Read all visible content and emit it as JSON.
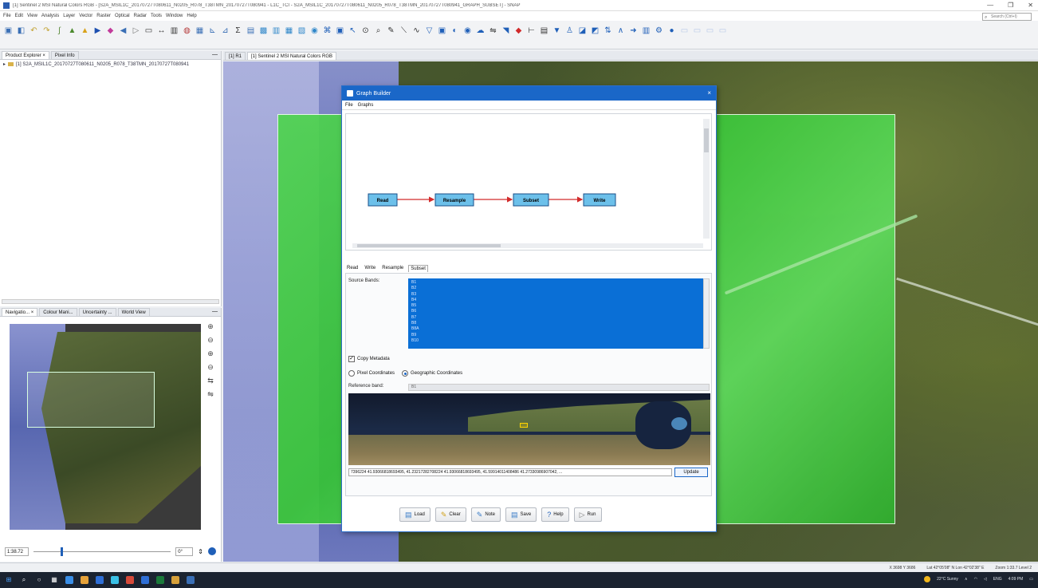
{
  "window": {
    "title": "[1] Sentinel 2 MSI Natural Colors RGB - [S2A_MSIL1C_20170727T080611_N0205_R078_T38TMN_20170727T080941 - L1C_TCI - S2A_MSIL1C_20170727T080611_N0205_R078_T38TMN_20170727T080941_GRAPH_SUBSET] - SNAP"
  },
  "menu": [
    "File",
    "Edit",
    "View",
    "Analysis",
    "Layer",
    "Vector",
    "Raster",
    "Optical",
    "Radar",
    "Tools",
    "Window",
    "Help"
  ],
  "search": {
    "placeholder": "Search (Ctrl+I)"
  },
  "toolbar": {
    "icons": [
      {
        "name": "open-product-icon",
        "glyph": "▣",
        "color": "#3a6fb5"
      },
      {
        "name": "session-icon",
        "glyph": "◧",
        "color": "#3a6fb5"
      },
      {
        "name": "undo-icon",
        "glyph": "↶",
        "color": "#c2a232"
      },
      {
        "name": "redo-icon",
        "glyph": "↷",
        "color": "#c2a232"
      },
      {
        "name": "band-maths-icon",
        "glyph": "∫",
        "color": "#5a8a3a"
      },
      {
        "name": "spectrum-icon",
        "glyph": "▲",
        "color": "#4c8a2e"
      },
      {
        "name": "mask-icon",
        "glyph": "▲",
        "color": "#d8a21b"
      },
      {
        "name": "pin-icon",
        "glyph": "▶",
        "color": "#1d4fb0"
      },
      {
        "name": "zoom-tool-icon",
        "glyph": "◆",
        "color": "#c23b9b"
      },
      {
        "name": "pan-tool-icon",
        "glyph": "◀",
        "color": "#3a6fb5"
      },
      {
        "name": "select-icon",
        "glyph": "▷",
        "color": "#777"
      },
      {
        "name": "rectangle-icon",
        "glyph": "▭",
        "color": "#333"
      },
      {
        "name": "measure-icon",
        "glyph": "↔",
        "color": "#333"
      },
      {
        "name": "histogram-icon",
        "glyph": "▥",
        "color": "#333"
      },
      {
        "name": "world-map-icon",
        "glyph": "◍",
        "color": "#b53a3a"
      },
      {
        "name": "scatter-icon",
        "glyph": "▦",
        "color": "#3a6fb5"
      },
      {
        "name": "profile-icon",
        "glyph": "⊾",
        "color": "#3a6fb5"
      },
      {
        "name": "chart-icon",
        "glyph": "⊿",
        "color": "#3a6fb5"
      },
      {
        "name": "statistics-icon",
        "glyph": "Σ",
        "color": "#333"
      },
      {
        "name": "layers-icon",
        "glyph": "▤",
        "color": "#3a6fb5"
      },
      {
        "name": "gcp-icon",
        "glyph": "▩",
        "color": "#2e86c9"
      },
      {
        "name": "graph-icon",
        "glyph": "▥",
        "color": "#2e86c9"
      },
      {
        "name": "spectral-icon",
        "glyph": "▦",
        "color": "#2e86c9"
      },
      {
        "name": "time-series-icon",
        "glyph": "▧",
        "color": "#2e86c9"
      },
      {
        "name": "colour-icon",
        "glyph": "◉",
        "color": "#2e86c9"
      },
      {
        "name": "graph-builder-icon",
        "glyph": "⌘",
        "color": "#1f5fb8"
      },
      {
        "name": "batch-icon",
        "glyph": "▣",
        "color": "#1f5fb8"
      },
      {
        "name": "cursor-icon",
        "glyph": "↖",
        "color": "#1f5fb8"
      },
      {
        "name": "ellipse-icon",
        "glyph": "⊙",
        "color": "#333"
      },
      {
        "name": "zoom-icon",
        "glyph": "⌕",
        "color": "#333"
      },
      {
        "name": "draw-icon",
        "glyph": "✎",
        "color": "#333"
      },
      {
        "name": "line-icon",
        "glyph": "⟍",
        "color": "#333"
      },
      {
        "name": "polyline-icon",
        "glyph": "∿",
        "color": "#333"
      },
      {
        "name": "polygon-icon",
        "glyph": "▽",
        "color": "#1f5fb8"
      },
      {
        "name": "pixel-info-icon",
        "glyph": "▣",
        "color": "#1f5fb8"
      },
      {
        "name": "range-finder-icon",
        "glyph": "◐",
        "color": "#1f5fb8"
      },
      {
        "name": "magic-wand-icon",
        "glyph": "◉",
        "color": "#1f5fb8"
      },
      {
        "name": "cloud-icon",
        "glyph": "☁",
        "color": "#1f5fb8"
      },
      {
        "name": "sync-cursor-icon",
        "glyph": "⇋",
        "color": "#333"
      },
      {
        "name": "insert-pin-icon",
        "glyph": "◥",
        "color": "#1f5fb8"
      },
      {
        "name": "insert-gcp-icon",
        "glyph": "◆",
        "color": "#d12a2a"
      },
      {
        "name": "split-icon",
        "glyph": "⊢",
        "color": "#333"
      },
      {
        "name": "bars-icon",
        "glyph": "▤",
        "color": "#333"
      },
      {
        "name": "mask-manager-icon",
        "glyph": "▼",
        "color": "#1f5fb8"
      },
      {
        "name": "user-icon",
        "glyph": "♙",
        "color": "#1f5fb8"
      },
      {
        "name": "filter-icon",
        "glyph": "◪",
        "color": "#1f5fb8"
      },
      {
        "name": "colour-manipulation-icon",
        "glyph": "◩",
        "color": "#1f5fb8"
      },
      {
        "name": "sync-view-icon",
        "glyph": "⇅",
        "color": "#1f5fb8"
      },
      {
        "name": "wavelength-icon",
        "glyph": "∧",
        "color": "#1f5fb8"
      },
      {
        "name": "arrow-icon",
        "glyph": "➜",
        "color": "#1f5fb8"
      },
      {
        "name": "analysis-icon",
        "glyph": "▥",
        "color": "#1f5fb8"
      },
      {
        "name": "settings-icon",
        "glyph": "⚙",
        "color": "#1f5fb8"
      },
      {
        "name": "globe-icon",
        "glyph": "●",
        "color": "#1f5fb8"
      },
      {
        "name": "tile-1-icon",
        "glyph": "▭",
        "color": "#b6c7e8"
      },
      {
        "name": "tile-2-icon",
        "glyph": "▭",
        "color": "#b6c7e8"
      },
      {
        "name": "tile-3-icon",
        "glyph": "▭",
        "color": "#b6c7e8"
      },
      {
        "name": "tile-4-icon",
        "glyph": "▭",
        "color": "#b6c7e8"
      }
    ]
  },
  "product_explorer": {
    "tabs": [
      "Product Explorer",
      "Pixel Info"
    ],
    "close": "×",
    "minimize": "—",
    "item": "[1] S2A_MSIL1C_20170727T080611_N0205_R078_T38TMN_20170727T080941"
  },
  "navigation": {
    "tabs": [
      "Navigatio...",
      "Colour Mani...",
      "Uncertainty ...",
      "World View"
    ],
    "close": "×",
    "minimize": "—",
    "scale": "1:38.72",
    "rotation": "0°",
    "zoom_in_icon": "+",
    "zoom_out_icon": "−"
  },
  "map_tabs": [
    "[1] R1",
    "[1] Sentinel 2 MSI Natural Colors RGB"
  ],
  "dialog": {
    "title": "Graph Builder",
    "close": "×",
    "menu": [
      "File",
      "Graphs"
    ],
    "nodes": [
      "Read",
      "Resample",
      "Subset",
      "Write"
    ],
    "tabs": [
      "Read",
      "Write",
      "Resample",
      "Subset"
    ],
    "active_tab": "Subset",
    "source_bands_label": "Source Bands:",
    "bands": [
      "B1",
      "B2",
      "B3",
      "B4",
      "B5",
      "B6",
      "B7",
      "B8",
      "B8A",
      "B9",
      "B10"
    ],
    "copy_metadata_label": "Copy Metadata",
    "copy_metadata_checked": true,
    "pixel_coordinates_label": "Pixel Coordinates",
    "geographic_coordinates_label": "Geographic Coordinates",
    "geo_selected": true,
    "reference_band_label": "Reference band:",
    "reference_band_value": "B1",
    "geo_region": "7396224 41.93066818693495, 41.23217282708224 41.93066818693495, 41.59914011408486 41.27330986907042, ...",
    "update_label": "Update",
    "buttons": [
      {
        "label": "Load",
        "icon": "▤",
        "color": "#3a7dc8"
      },
      {
        "label": "Clear",
        "icon": "✎",
        "color": "#d1a21c"
      },
      {
        "label": "Note",
        "icon": "✎",
        "color": "#3a7dc8"
      },
      {
        "label": "Save",
        "icon": "▤",
        "color": "#3a7dc8"
      },
      {
        "label": "Help",
        "icon": "?",
        "color": "#1f5fb8"
      },
      {
        "label": "Run",
        "icon": "▷",
        "color": "#777"
      }
    ]
  },
  "status": {
    "position": "X 3698 Y 3686",
    "lat_lon": "Lat 42°05'08\" N Lon 42°02'38\" E",
    "zoom": "Zoom 1:33.7 Level 2"
  },
  "taskbar": {
    "weather": "22°C Sunny",
    "time": "4:09 PM",
    "lang": "ENG"
  },
  "colors": {
    "accent": "#1a67c8",
    "node_fill": "#6cc0ea",
    "edge": "#d22b2b"
  }
}
